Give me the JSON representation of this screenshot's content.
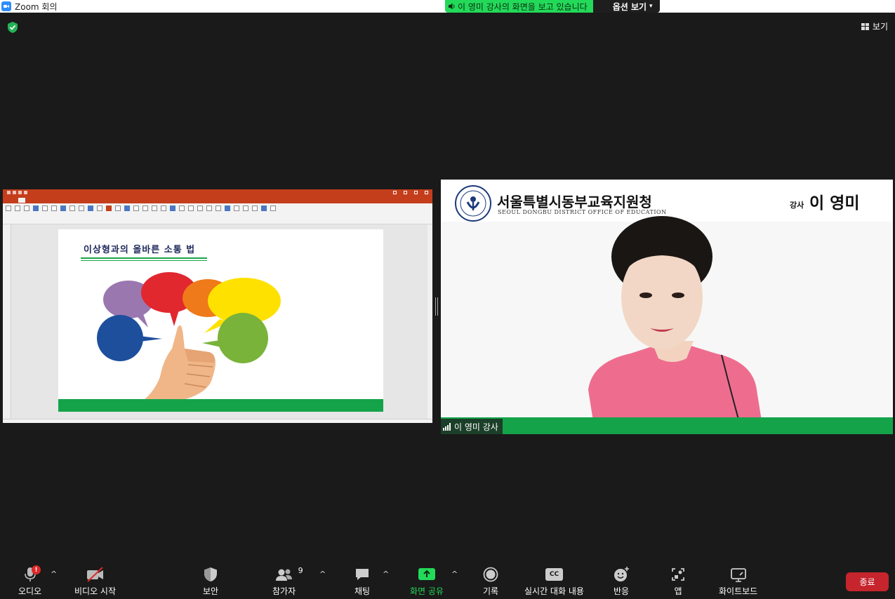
{
  "window": {
    "title": "Zoom 회의"
  },
  "share_banner": {
    "text": "이 영미 강사의 화면을 보고 있습니다",
    "options_label": "옵션 보기"
  },
  "view_button": {
    "label": "보기"
  },
  "shared_slide": {
    "title": "이상형과의 올바른 소통 법"
  },
  "presenter": {
    "org_name_ko": "서울특별시동부교육지원청",
    "org_name_en": "SEOUL DONGBU DISTRICT OFFICE OF EDUCATION",
    "role_label": "강사",
    "name_banner": "이 영미",
    "participant_label": "이 영미 강사"
  },
  "toolbar": {
    "audio_label": "오디오",
    "audio_badge": "!",
    "video_label": "비디오 시작",
    "security_label": "보안",
    "participants_label": "참가자",
    "participants_count": "9",
    "chat_label": "채팅",
    "share_label": "화면 공유",
    "record_label": "기록",
    "captions_label": "실시간 대화 내용",
    "captions_icon_text": "CC",
    "reactions_label": "반응",
    "apps_label": "앱",
    "whiteboard_label": "화이트보드",
    "end_label": "종료"
  },
  "colors": {
    "zoom_blue": "#2d8cff",
    "share_green": "#23d959",
    "end_red": "#c6252d",
    "ppt_red": "#c43e1c",
    "slide_green": "#15a34a"
  }
}
